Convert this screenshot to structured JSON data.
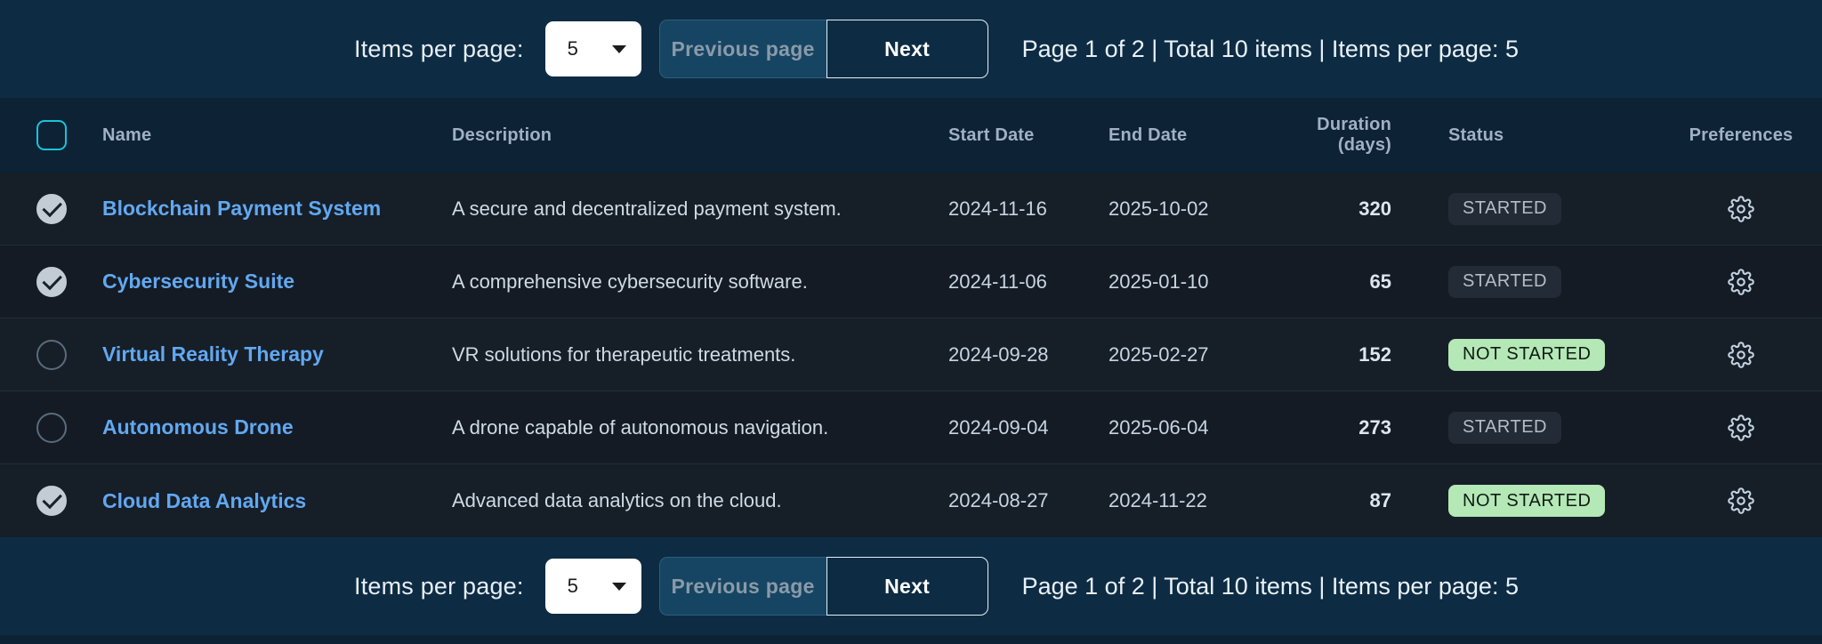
{
  "paginator": {
    "items_per_page_label": "Items per page:",
    "items_per_page_value": "5",
    "previous_label": "Previous page",
    "next_label": "Next",
    "status": "Page 1 of 2 | Total 10 items | Items per page: 5",
    "page": 1,
    "total_pages": 2,
    "total_items": 10
  },
  "table": {
    "headers": {
      "name": "Name",
      "description": "Description",
      "start_date": "Start Date",
      "end_date": "End Date",
      "duration": "Duration (days)",
      "status": "Status",
      "preferences": "Preferences"
    },
    "select_all_checked": false,
    "rows": [
      {
        "checked": true,
        "name": "Blockchain Payment System",
        "description": "A secure and decentralized payment system.",
        "start_date": "2024-11-16",
        "end_date": "2025-10-02",
        "duration": "320",
        "status": "STARTED"
      },
      {
        "checked": true,
        "name": "Cybersecurity Suite",
        "description": "A comprehensive cybersecurity software.",
        "start_date": "2024-11-06",
        "end_date": "2025-01-10",
        "duration": "65",
        "status": "STARTED"
      },
      {
        "checked": false,
        "name": "Virtual Reality Therapy",
        "description": "VR solutions for therapeutic treatments.",
        "start_date": "2024-09-28",
        "end_date": "2025-02-27",
        "duration": "152",
        "status": "NOT STARTED"
      },
      {
        "checked": false,
        "name": "Autonomous Drone",
        "description": "A drone capable of autonomous navigation.",
        "start_date": "2024-09-04",
        "end_date": "2025-06-04",
        "duration": "273",
        "status": "STARTED"
      },
      {
        "checked": true,
        "name": "Cloud Data Analytics",
        "description": "Advanced data analytics on the cloud.",
        "start_date": "2024-08-27",
        "end_date": "2024-11-22",
        "duration": "87",
        "status": "NOT STARTED"
      }
    ]
  },
  "colors": {
    "bar_background": "#0d2c44",
    "table_background": "#161e28",
    "link": "#62a8f0",
    "accent_checkbox": "#19c4d8",
    "badge_not_started_bg": "#b4e8b6",
    "badge_started_bg": "#232b36"
  },
  "icons": {
    "gear": "gear-icon",
    "caret": "chevron-down-icon",
    "check": "check-icon"
  }
}
